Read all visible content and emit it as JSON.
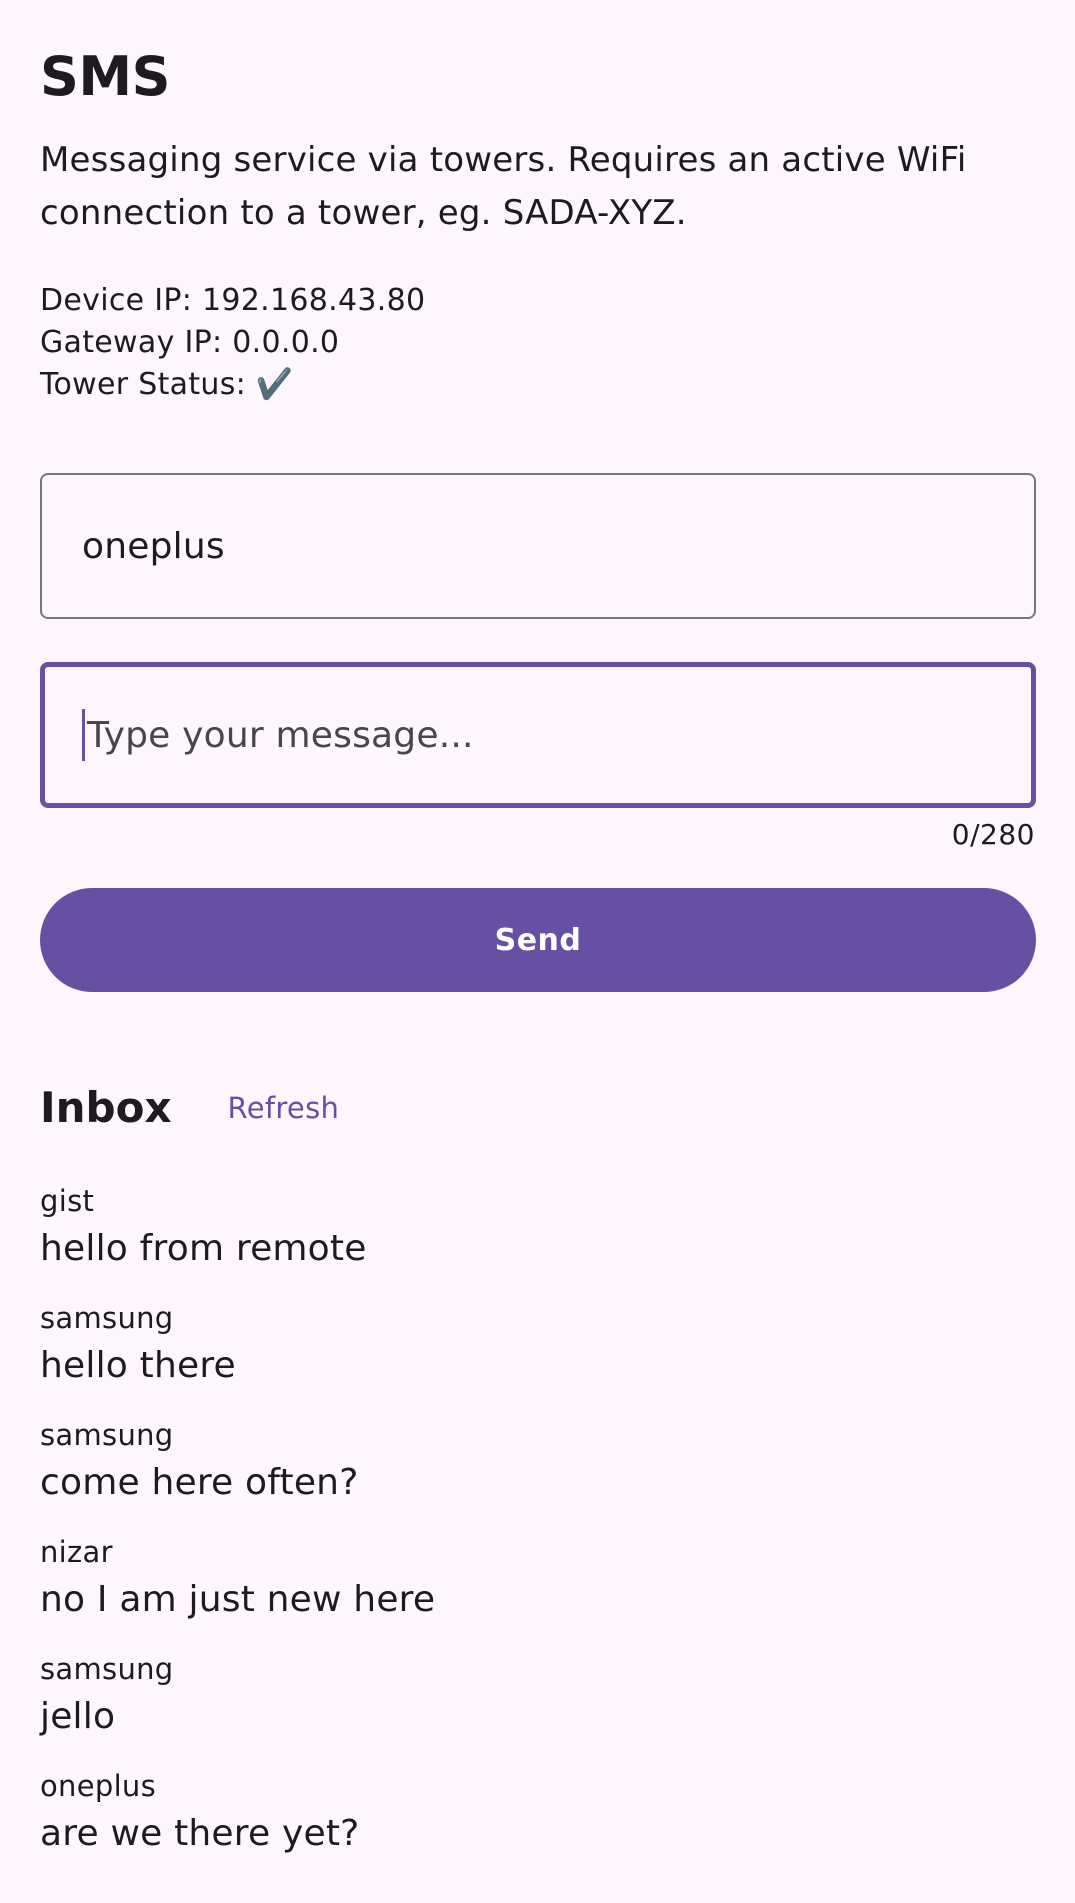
{
  "header": {
    "title": "SMS",
    "description": "Messaging service via towers. Requires an active WiFi connection to a tower, eg. SADA-XYZ."
  },
  "status": {
    "device_ip": "Device IP: 192.168.43.80",
    "gateway_ip": "Gateway IP: 0.0.0.0",
    "tower_status_label": "Tower Status: ",
    "tower_status_icon": "check-mark-icon",
    "tower_status_glyph": "✔️"
  },
  "form": {
    "recipient_value": "oneplus",
    "message_value": "",
    "message_placeholder": "Type your message...",
    "char_counter": "0/280",
    "send_label": "Send"
  },
  "inbox": {
    "title": "Inbox",
    "refresh_label": "Refresh",
    "messages": [
      {
        "sender": "gist",
        "text": "hello from remote"
      },
      {
        "sender": "samsung",
        "text": "hello there"
      },
      {
        "sender": "samsung",
        "text": "come here often?"
      },
      {
        "sender": "nizar",
        "text": "no I am just new here"
      },
      {
        "sender": "samsung",
        "text": "jello"
      },
      {
        "sender": "oneplus",
        "text": "are we there yet?"
      }
    ]
  },
  "colors": {
    "background": "#fdf7fd",
    "primary": "#6750a4",
    "outline": "#79747e",
    "text": "#1d1b20"
  }
}
